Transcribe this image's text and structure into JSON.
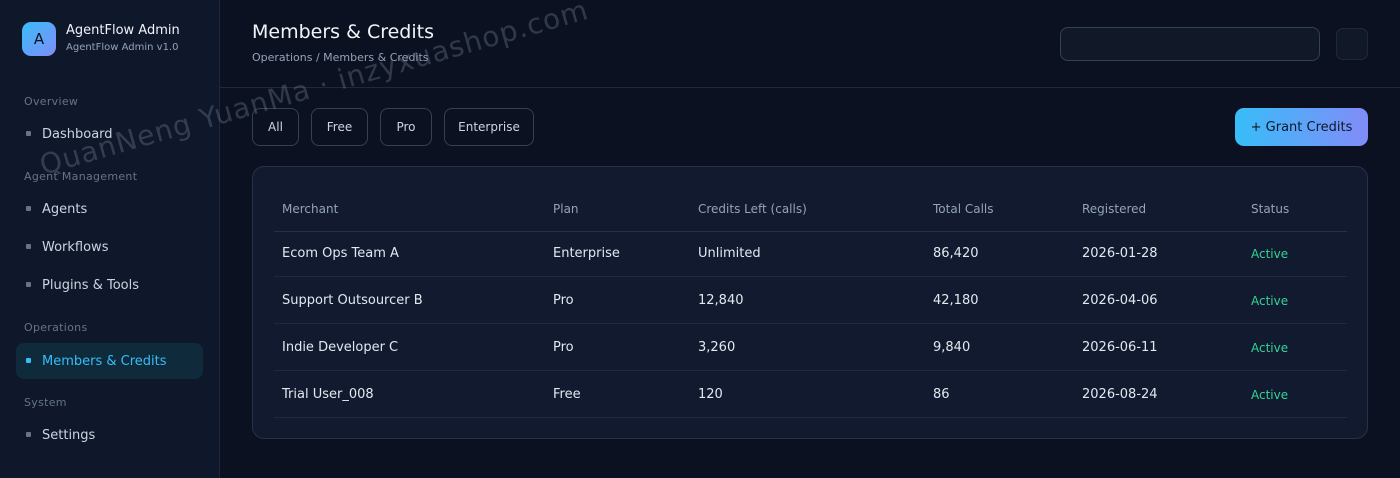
{
  "sidebar": {
    "brand_initial": "A",
    "brand_name": "AgentFlow Admin",
    "brand_version": "AgentFlow Admin v1.0",
    "sections": [
      {
        "title": "Overview",
        "items": [
          {
            "label": "Dashboard",
            "icon": "square-dot-icon",
            "active": false
          }
        ]
      },
      {
        "title": "Agent Management",
        "items": [
          {
            "label": "Agents",
            "icon": "square-dot-icon",
            "active": false
          },
          {
            "label": "Workflows",
            "icon": "square-dot-icon",
            "active": false
          },
          {
            "label": "Plugins & Tools",
            "icon": "square-dot-icon",
            "active": false
          }
        ]
      },
      {
        "title": "Operations",
        "items": [
          {
            "label": "Members & Credits",
            "icon": "square-dot-icon",
            "active": true
          }
        ]
      },
      {
        "title": "System",
        "items": [
          {
            "label": "Settings",
            "icon": "square-dot-icon",
            "active": false
          }
        ]
      }
    ]
  },
  "header": {
    "title": "Members & Credits",
    "breadcrumb": "Operations / Members & Credits",
    "search_value": ""
  },
  "filters": [
    "All",
    "Free",
    "Pro",
    "Enterprise"
  ],
  "actions": {
    "grant_label": "+ Grant Credits"
  },
  "table": {
    "columns": [
      "Merchant",
      "Plan",
      "Credits Left (calls)",
      "Total Calls",
      "Registered",
      "Status"
    ],
    "rows": [
      [
        "Ecom Ops Team A",
        "Enterprise",
        "Unlimited",
        "86,420",
        "2026-01-28",
        "Active"
      ],
      [
        "Support Outsourcer B",
        "Pro",
        "12,840",
        "42,180",
        "2026-04-06",
        "Active"
      ],
      [
        "Indie Developer C",
        "Pro",
        "3,260",
        "9,840",
        "2026-06-11",
        "Active"
      ],
      [
        "Trial User_008",
        "Free",
        "120",
        "86",
        "2026-08-24",
        "Active"
      ]
    ]
  },
  "watermark": "QuanNeng YuanMa · inzyxuashop.com",
  "colors": {
    "accent": "#38bdf8",
    "accent_secondary": "#818cf8",
    "status_active": "#34d399",
    "background": "#0b1120"
  }
}
